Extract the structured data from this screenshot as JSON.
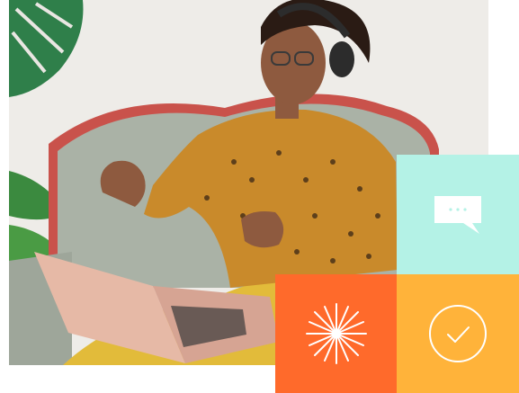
{
  "photo": {
    "subject": "woman-with-headphones-and-laptop"
  },
  "tiles": {
    "chat": {
      "icon": "chat-bubble-icon",
      "color": "#b4f2e6"
    },
    "spark": {
      "icon": "sparkle-icon",
      "color": "#ff6a2b"
    },
    "check": {
      "icon": "check-circle-icon",
      "color": "#ffb33a"
    }
  },
  "colors": {
    "sofa": "#aab2a6",
    "sofa_frame": "#c9524b",
    "leaf": "#2f7f4a",
    "shirt": "#c98a2b",
    "pants": "#e2bb3a",
    "laptop": "#e6b9a6",
    "skin": "#8e5a3f",
    "hair": "#2a1b14"
  }
}
